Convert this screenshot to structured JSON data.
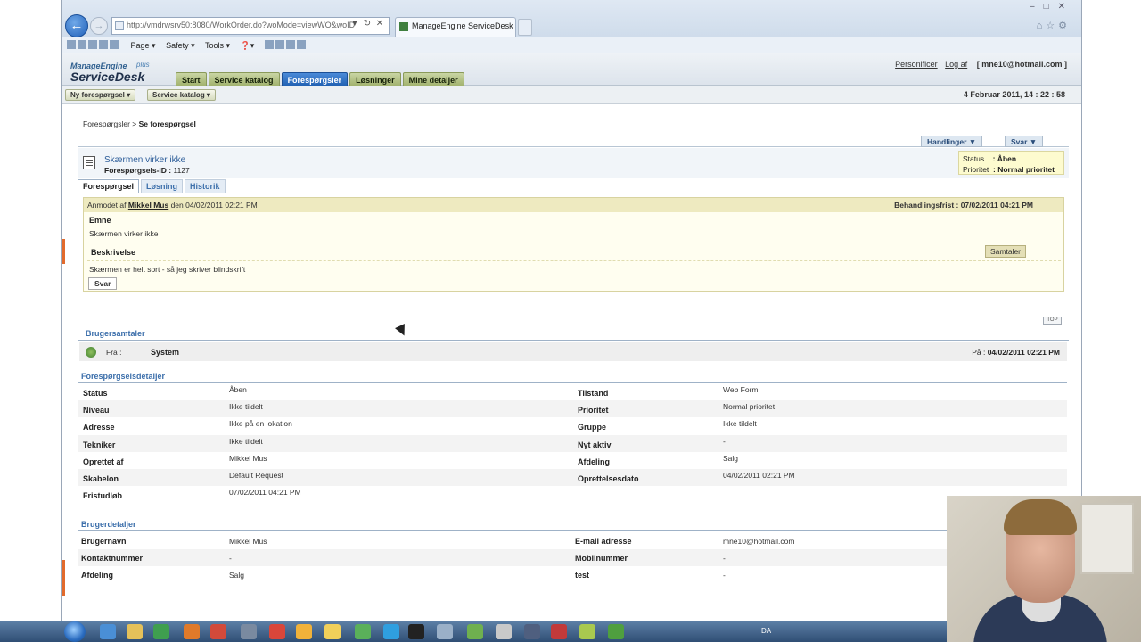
{
  "browser": {
    "url": "http://vmdrwsrv50:8080/WorkOrder.do?woMode=viewWO&woID",
    "tab_title": "ManageEngine ServiceDesk P...",
    "command_bar": [
      "Page ▾",
      "Safety ▾",
      "Tools ▾",
      "❓▾"
    ]
  },
  "app": {
    "logo_top": "ManageEngine",
    "logo_main": "ServiceDesk",
    "logo_plus": "plus",
    "tabs": [
      "Start",
      "Service katalog",
      "Forespørgsler",
      "Løsninger",
      "Mine detaljer"
    ],
    "active_tab": "Forespørgsler",
    "personalize": "Personificer",
    "logout": "Log af",
    "user_email": "[ mne10@hotmail.com ]",
    "new_request": "Ny forespørgsel ▾",
    "service_catalog": "Service katalog ▾",
    "datetime": "4 Februar 2011, 14 : 22 : 58"
  },
  "breadcrumb": {
    "link": "Forespørgsler",
    "separator": " > ",
    "current": "Se forespørgsel"
  },
  "actions": {
    "handlinger": "Handlinger ▼",
    "svar": "Svar ▼"
  },
  "request": {
    "title": "Skærmen virker ikke",
    "id_label": "Forespørgsels-ID :",
    "id_value": "1127",
    "status_label": "Status",
    "status_value": ": Åben",
    "priority_label": "Prioritet",
    "priority_value": ": Normal prioritet"
  },
  "subtabs": [
    "Forespørgsel",
    "Løsning",
    "Historik"
  ],
  "request_box": {
    "requested_by_prefix": "Anmodet af ",
    "requester": "Mikkel Mus",
    "requested_on": " den 04/02/2011 02:21 PM",
    "deadline": "Behandlingsfrist : 07/02/2011 04:21 PM",
    "subject_label": "Emne",
    "subject": "Skærmen virker ikke",
    "description_label": "Beskrivelse",
    "description": "Skærmen er helt sort - så jeg skriver blindskrift",
    "conversations_btn": "Samtaler",
    "reply_btn": "Svar"
  },
  "top_link": "TOP",
  "conversations": {
    "title": "Brugersamtaler",
    "from_label": "Fra :",
    "from_value": "System",
    "date_label": "På :",
    "date_value": "04/02/2011 02:21 PM"
  },
  "details": {
    "title": "Forespørgselsdetaljer",
    "rows": [
      {
        "l1": "Status",
        "v1": "Åben",
        "l2": "Tilstand",
        "v2": "Web Form"
      },
      {
        "l1": "Niveau",
        "v1": "Ikke tildelt",
        "l2": "Prioritet",
        "v2": "Normal prioritet"
      },
      {
        "l1": "Adresse",
        "v1": "Ikke på en lokation",
        "l2": "Gruppe",
        "v2": "Ikke tildelt"
      },
      {
        "l1": "Tekniker",
        "v1": "Ikke tildelt",
        "l2": "Nyt aktiv",
        "v2": "-"
      },
      {
        "l1": "Oprettet af",
        "v1": "Mikkel Mus",
        "l2": "Afdeling",
        "v2": "Salg"
      },
      {
        "l1": "Skabelon",
        "v1": "Default Request",
        "l2": "Oprettelsesdato",
        "v2": "04/02/2011 02:21 PM"
      },
      {
        "l1": "Fristudløb",
        "v1": "07/02/2011 04:21 PM",
        "l2": "",
        "v2": ""
      }
    ]
  },
  "user_details": {
    "title": "Brugerdetaljer",
    "rows": [
      {
        "l1": "Brugernavn",
        "v1": "Mikkel Mus",
        "l2": "E-mail adresse",
        "v2": "mne10@hotmail.com"
      },
      {
        "l1": "Kontaktnummer",
        "v1": "-",
        "l2": "Mobilnummer",
        "v2": "-"
      },
      {
        "l1": "Afdeling",
        "v1": "Salg",
        "l2": "test",
        "v2": "-"
      }
    ]
  },
  "taskbar": {
    "language": "DA"
  },
  "colors": {
    "active_tab": "#1f5fb0",
    "tab": "#9fb06a",
    "section_title": "#3c6fab",
    "status_box": "#fdfbcf",
    "accent_marker": "#e26a2c"
  }
}
